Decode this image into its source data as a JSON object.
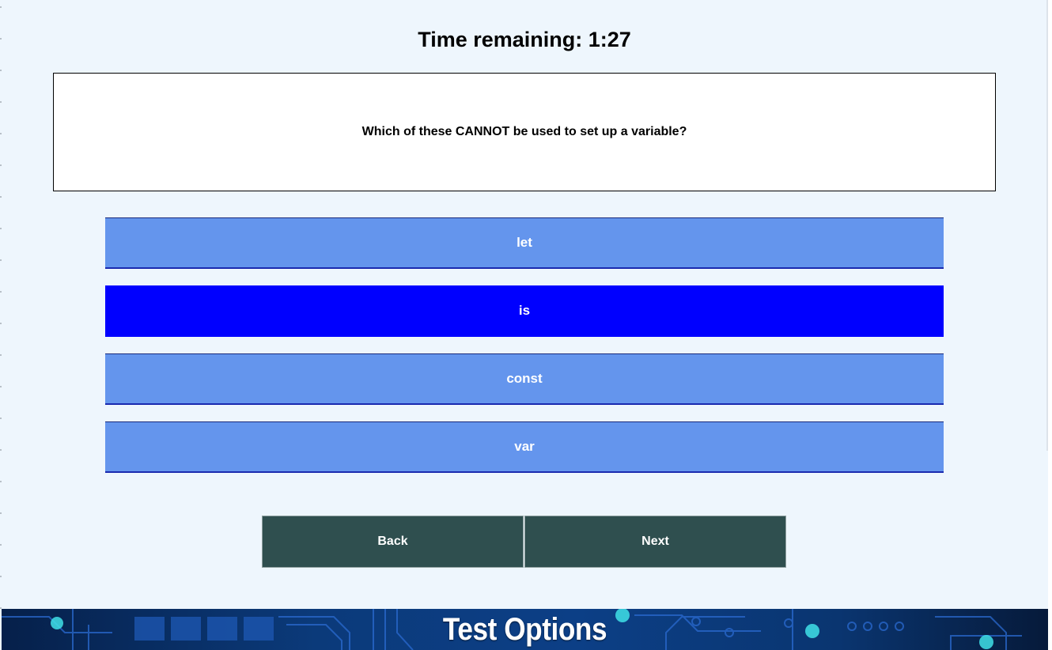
{
  "timer": {
    "label": "Time remaining: 1:27"
  },
  "question": {
    "text": "Which of these CANNOT be used to set up a variable?"
  },
  "options": [
    {
      "label": "let",
      "selected": false
    },
    {
      "label": "is",
      "selected": true
    },
    {
      "label": "const",
      "selected": false
    },
    {
      "label": "var",
      "selected": false
    }
  ],
  "nav": {
    "back_label": "Back",
    "next_label": "Next"
  },
  "footer": {
    "title": "Test Options"
  },
  "colors": {
    "page_bg": "#eef6fd",
    "option": "#6495ed",
    "option_selected": "#0000ff",
    "nav_button": "#2f4f4f"
  }
}
